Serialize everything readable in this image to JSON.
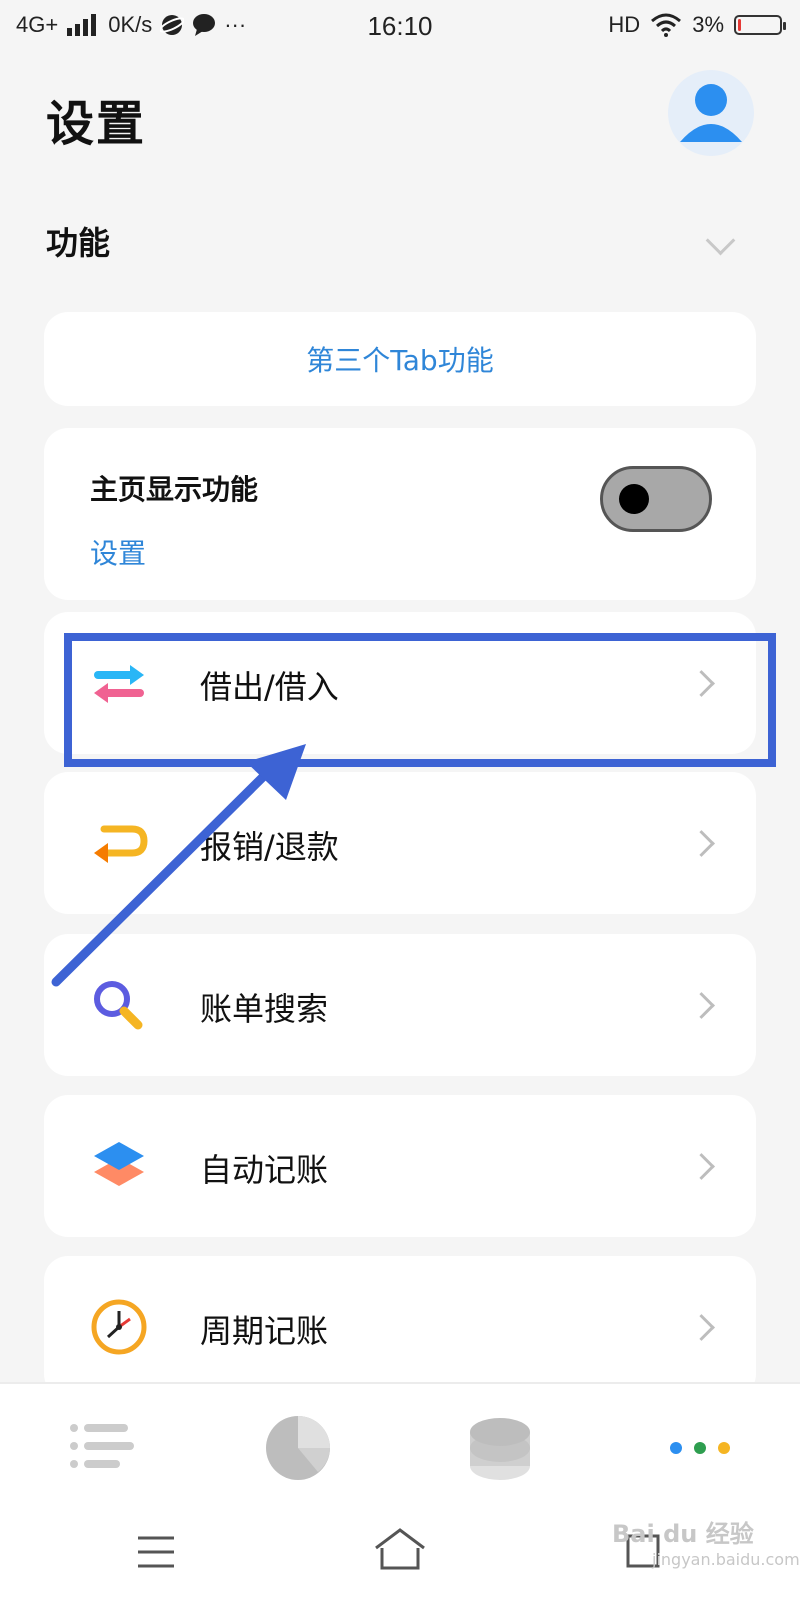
{
  "status_bar": {
    "left_text": "4G+",
    "network_speed": "0K/s",
    "dots": "···",
    "time": "16:10",
    "hd": "HD",
    "battery_percent": "3%",
    "battery_level": 0.03
  },
  "header": {
    "title": "设置",
    "avatar_icon": "user-avatar-icon"
  },
  "section": {
    "title": "功能",
    "collapse_icon": "chevron-down-icon"
  },
  "tab_button": {
    "label": "第三个Tab功能"
  },
  "home_display": {
    "label": "主页显示功能",
    "link": "设置",
    "toggle_on": false
  },
  "items": [
    {
      "label": "借出/借入",
      "icon": "transfer-arrows-icon"
    },
    {
      "label": "报销/退款",
      "icon": "return-arrow-icon"
    },
    {
      "label": "账单搜索",
      "icon": "search-icon"
    },
    {
      "label": "自动记账",
      "icon": "layers-icon"
    },
    {
      "label": "周期记账",
      "icon": "clock-icon"
    }
  ],
  "annotation": {
    "color": "#3d63d4"
  },
  "bottom_nav": [
    "list-icon",
    "pie-chart-icon",
    "coins-icon",
    "more-dots-icon"
  ],
  "system_nav": [
    "menu-icon",
    "home-icon",
    "back-icon"
  ],
  "watermark": {
    "brand": "Bai du",
    "suffix": "经验",
    "url": "jingyan.baidu.com"
  },
  "colors": {
    "link_blue": "#2f86d8",
    "accent_blue": "#2f86d8",
    "highlight": "#3d63d4"
  }
}
